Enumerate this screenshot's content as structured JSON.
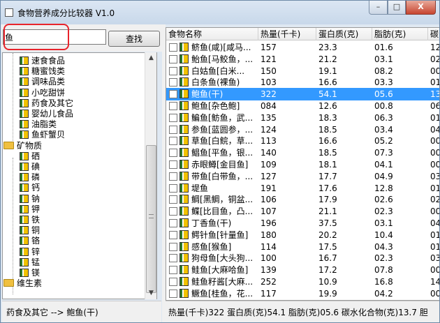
{
  "window": {
    "title": "食物营养成分比较器 V1.0",
    "app_icon": "app-icon",
    "minimize_label": "–",
    "maximize_label": "□",
    "close_label": "X"
  },
  "search": {
    "value": "鱼",
    "button_label": "查找"
  },
  "tree": {
    "items": [
      {
        "label": "速食食品",
        "icon": "food-icon"
      },
      {
        "label": "糖蜜饯类",
        "icon": "food-icon"
      },
      {
        "label": "调味品类",
        "icon": "food-icon"
      },
      {
        "label": "小吃甜饼",
        "icon": "food-icon"
      },
      {
        "label": "药食及其它",
        "icon": "food-icon"
      },
      {
        "label": "婴幼儿食品",
        "icon": "food-icon"
      },
      {
        "label": "油脂类",
        "icon": "food-icon"
      },
      {
        "label": "鱼虾蟹贝",
        "icon": "food-icon"
      },
      {
        "label": "矿物质",
        "icon": "folder-icon"
      },
      {
        "label": "硒",
        "icon": "food-icon"
      },
      {
        "label": "碘",
        "icon": "food-icon"
      },
      {
        "label": "磷",
        "icon": "food-icon"
      },
      {
        "label": "钙",
        "icon": "food-icon"
      },
      {
        "label": "钠",
        "icon": "food-icon"
      },
      {
        "label": "钾",
        "icon": "food-icon"
      },
      {
        "label": "铁",
        "icon": "food-icon"
      },
      {
        "label": "铜",
        "icon": "food-icon"
      },
      {
        "label": "铬",
        "icon": "food-icon"
      },
      {
        "label": "锌",
        "icon": "food-icon"
      },
      {
        "label": "锰",
        "icon": "food-icon"
      },
      {
        "label": "镁",
        "icon": "food-icon"
      },
      {
        "label": "维生素",
        "icon": "folder-icon"
      }
    ]
  },
  "table": {
    "columns": [
      "食物名称",
      "热量(千卡)",
      "蛋白质(克)",
      "脂肪(克)",
      "碳"
    ],
    "rows": [
      [
        "鲚鱼(咸)[咸马...",
        "157",
        "23.3",
        "01.6",
        "12"
      ],
      [
        "鲐鱼[马鲛鱼，...",
        "121",
        "21.2",
        "03.1",
        "02"
      ],
      [
        "白姑鱼[白米...",
        "150",
        "19.1",
        "08.2",
        "00"
      ],
      [
        "白条鱼(裸鱼)",
        "103",
        "16.6",
        "03.3",
        "01"
      ],
      [
        "鲍鱼(干)",
        "322",
        "54.1",
        "05.6",
        "13"
      ],
      [
        "鲍鱼[杂色鲍]",
        "084",
        "12.6",
        "00.8",
        "06"
      ],
      [
        "鳊鱼[鲂鱼，武...",
        "135",
        "18.3",
        "06.3",
        "01"
      ],
      [
        "参鱼[蓝圆参，...",
        "124",
        "18.5",
        "03.4",
        "04"
      ],
      [
        "草鱼[白鲩，草...",
        "113",
        "16.6",
        "05.2",
        "00"
      ],
      [
        "鲳鱼[平鱼，银...",
        "140",
        "18.5",
        "07.3",
        "00"
      ],
      [
        "赤眼鳟[金目鱼]",
        "109",
        "18.1",
        "04.1",
        "00"
      ],
      [
        "带鱼[白带鱼，...",
        "127",
        "17.7",
        "04.9",
        "03"
      ],
      [
        "堤鱼",
        "191",
        "17.6",
        "12.8",
        "01"
      ],
      [
        "鲷[黑鲷，铜盆...",
        "106",
        "17.9",
        "02.6",
        "02"
      ],
      [
        "鲽[比目鱼，凸...",
        "107",
        "21.1",
        "02.3",
        "00"
      ],
      [
        "丁香鱼(干)",
        "196",
        "37.5",
        "03.1",
        "04"
      ],
      [
        "鳄针鱼[针量鱼]",
        "180",
        "20.2",
        "10.4",
        "01"
      ],
      [
        "感鱼[猴鱼]",
        "114",
        "17.5",
        "04.3",
        "01"
      ],
      [
        "狗母鱼[大头狗...",
        "100",
        "16.7",
        "02.3",
        "03"
      ],
      [
        "鲑鱼[大麻哈鱼]",
        "139",
        "17.2",
        "07.8",
        "00"
      ],
      [
        "鲑鱼籽酱[大麻...",
        "252",
        "10.9",
        "16.8",
        "14"
      ],
      [
        "鳜鱼[桂鱼，花...",
        "117",
        "19.9",
        "04.2",
        "00"
      ]
    ],
    "selected_index": 4
  },
  "status": {
    "left": "药食及其它 --> 鲍鱼(干)",
    "right": "热量(千卡)322 蛋白质(克)54.1 脂肪(克)05.6 碳水化合物(克)13.7 胆"
  },
  "colors": {
    "selection": "#3399ff",
    "highlight_box": "#e8232b",
    "folder": "#f0c040"
  }
}
